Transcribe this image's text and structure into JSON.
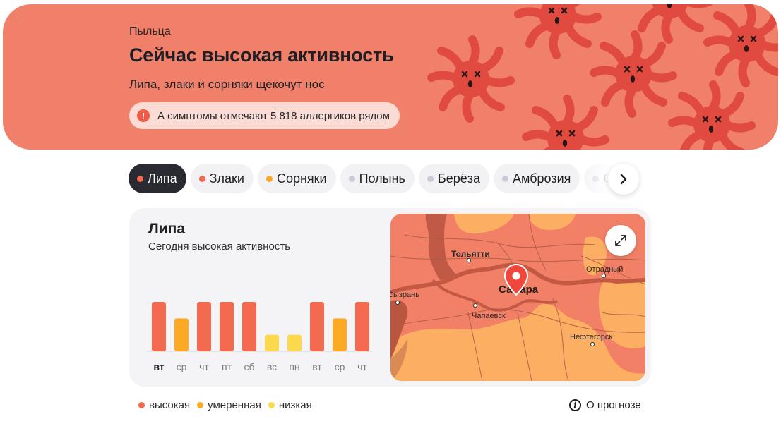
{
  "hero": {
    "label": "Пыльца",
    "title": "Сейчас высокая активность",
    "description": "Липа, злаки и сорняки щекочут нос",
    "alert_icon": "!",
    "alert_text": "А симптомы отмечают 5 818 аллергиков рядом",
    "colors": {
      "background": "#f08069",
      "pollen": "#e04a3f"
    }
  },
  "tabs": [
    {
      "label": "Липа",
      "dot_color": "#f36a50",
      "active": true
    },
    {
      "label": "Злаки",
      "dot_color": "#f36a50",
      "active": false
    },
    {
      "label": "Сорняки",
      "dot_color": "#fcaa25",
      "active": false
    },
    {
      "label": "Полынь",
      "dot_color": "#c9cbd6",
      "active": false
    },
    {
      "label": "Берёза",
      "dot_color": "#c9cbd6",
      "active": false
    },
    {
      "label": "Амброзия",
      "dot_color": "#c9cbd6",
      "active": false
    },
    {
      "label": "Ольха",
      "dot_color": "#c9cbd6",
      "active": false
    }
  ],
  "tabs_next_icon": "chevron-right-icon",
  "card": {
    "title": "Липа",
    "subtitle": "Сегодня высокая активность"
  },
  "chart_data": {
    "type": "bar",
    "categories": [
      "вт",
      "ср",
      "чт",
      "пт",
      "сб",
      "вс",
      "пн",
      "вт",
      "ср",
      "чт"
    ],
    "values": [
      3,
      2,
      3,
      3,
      3,
      1,
      1,
      3,
      2,
      3
    ],
    "levels": [
      "high",
      "moderate",
      "high",
      "high",
      "high",
      "low",
      "low",
      "high",
      "moderate",
      "high"
    ],
    "highlight_index": 0,
    "ylim": [
      0,
      3
    ],
    "colors": {
      "high": "#f36a50",
      "moderate": "#fcaa25",
      "low": "#fcd94c"
    },
    "title": "",
    "xlabel": "",
    "ylabel": ""
  },
  "map": {
    "labels": {
      "tolyatti": "Тольятти",
      "otradny": "Отрадный",
      "syzran": "Сызрань",
      "samara": "Самара",
      "chapaevsk": "Чапаевск",
      "neftegorsk": "Нефтегорск"
    },
    "expand_icon": "expand-icon",
    "pin_icon": "location-pin-icon"
  },
  "legend": [
    {
      "label": "высокая",
      "color": "#f36a50"
    },
    {
      "label": "умеренная",
      "color": "#fcaa25"
    },
    {
      "label": "низкая",
      "color": "#fcd94c"
    }
  ],
  "forecast": {
    "icon": "i",
    "label": "О прогнозе"
  }
}
